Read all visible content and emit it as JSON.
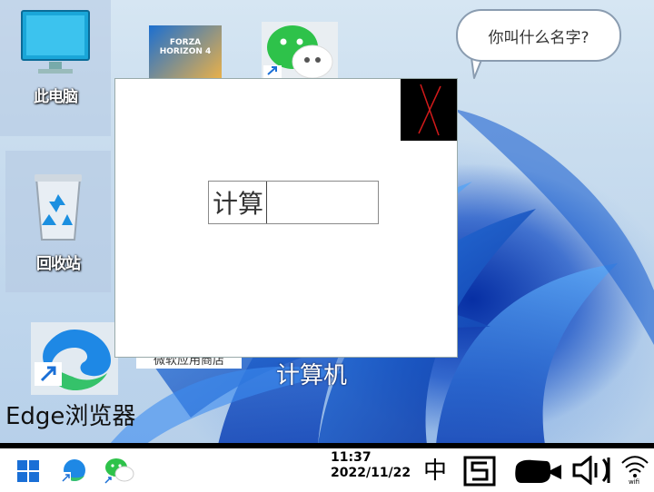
{
  "desktop": {
    "icons": {
      "this_pc": {
        "label": "此电脑"
      },
      "recycle_bin": {
        "label": "回收站"
      },
      "edge": {
        "label": "Edge浏览器"
      },
      "store": {
        "label": "微软应用商店"
      },
      "calculator": {
        "label": "计算机"
      },
      "forza": {
        "label": "FORZA HORIZON 4"
      }
    }
  },
  "speech_bubble": {
    "text": "你叫什么名字?"
  },
  "dialog": {
    "input_value": "计算"
  },
  "taskbar": {
    "time": "11:37",
    "date": "2022/11/22",
    "ime": "中",
    "wifi_label": "wifi"
  },
  "colors": {
    "close_bg": "#000000",
    "close_x": "#d11a1a",
    "taskbar_bg": "#ffffff",
    "win_blue": "#1a6fd6"
  }
}
